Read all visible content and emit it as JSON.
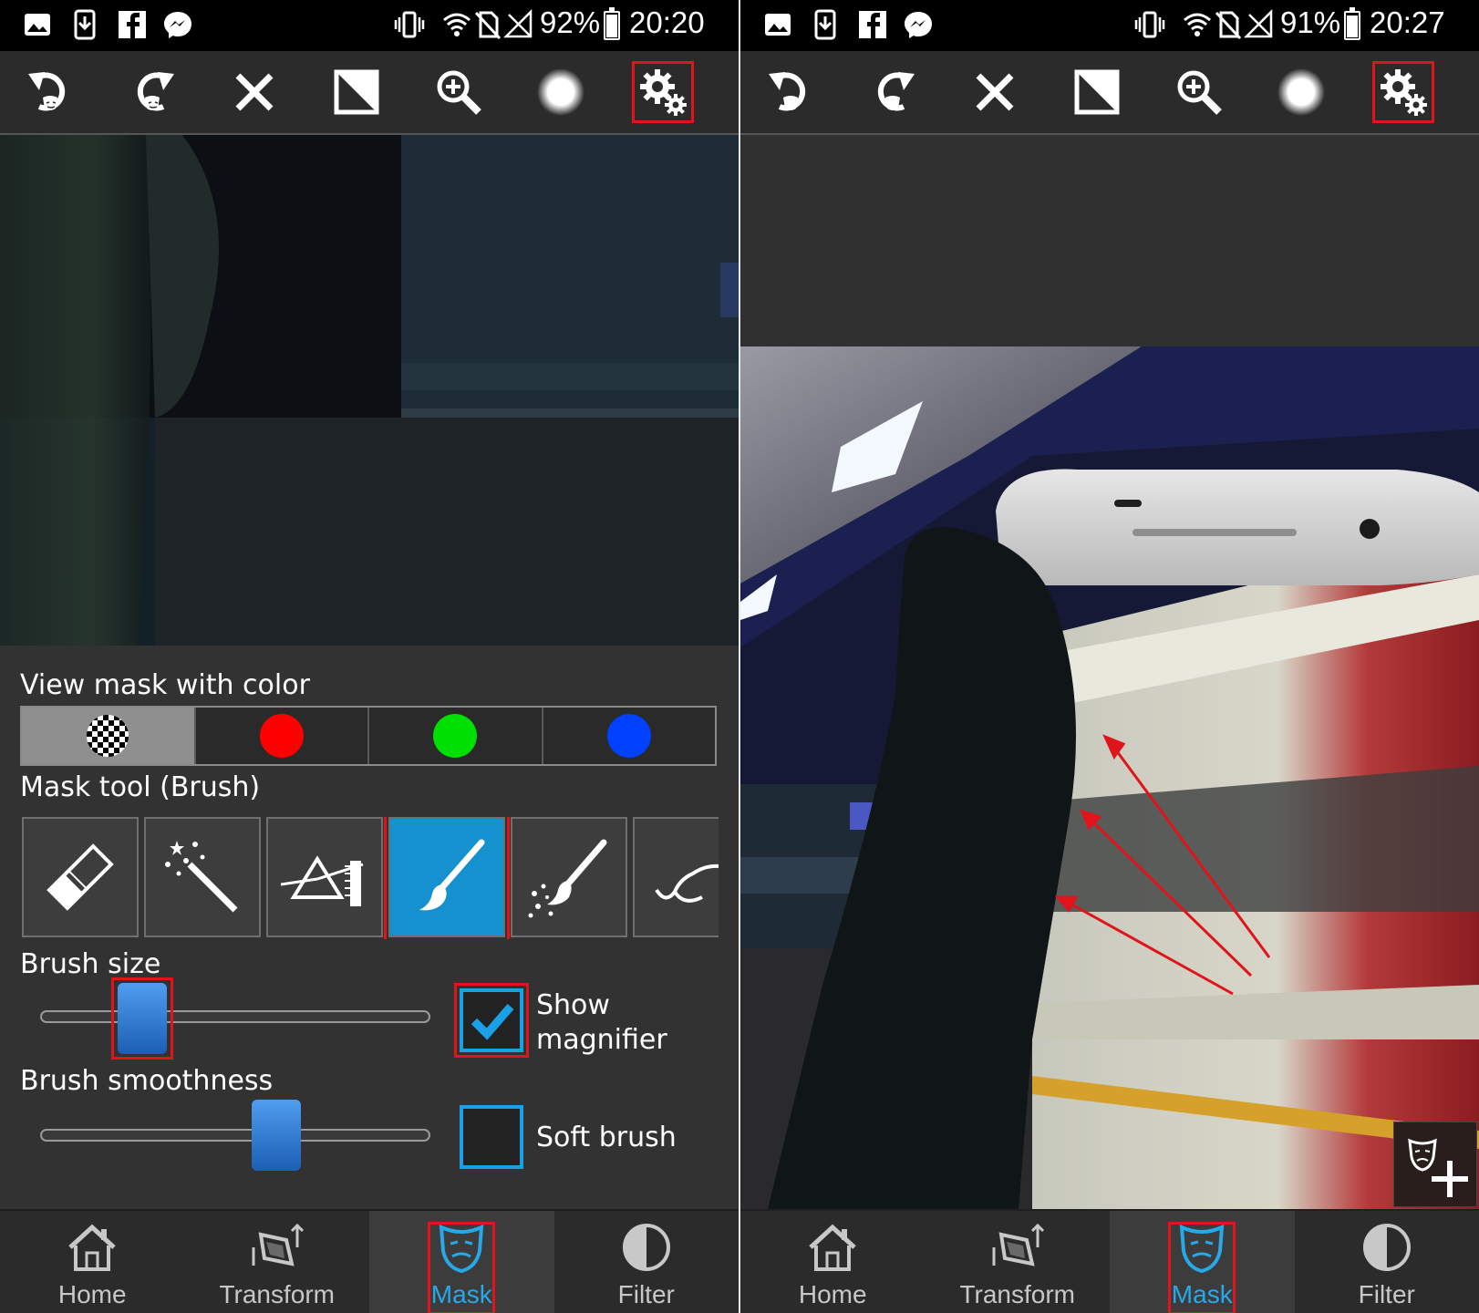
{
  "left": {
    "status": {
      "battery": "92%",
      "time": "20:20"
    },
    "settings": {
      "view_mask_label": "View mask with color",
      "mask_colors": [
        "transparent",
        "red",
        "green",
        "blue"
      ],
      "mask_color_hex": [
        "checker",
        "#ff0000",
        "#00e000",
        "#0040ff"
      ],
      "mask_tool_label": "Mask tool (Brush)",
      "tools": [
        "eraser",
        "magic-wand",
        "prism",
        "brush",
        "sparkle-brush",
        "lasso"
      ],
      "active_tool": "brush",
      "brush_size_label": "Brush size",
      "brush_size_value": 0.25,
      "brush_smoothness_label": "Brush smoothness",
      "brush_smoothness_value": 0.6,
      "show_magnifier_label": "Show\nmagnifier",
      "show_magnifier_checked": true,
      "soft_brush_label": "Soft brush",
      "soft_brush_checked": false
    }
  },
  "right": {
    "status": {
      "battery": "91%",
      "time": "20:27"
    }
  },
  "nav": [
    "Home",
    "Transform",
    "Mask",
    "Filter"
  ],
  "active_nav": "Mask",
  "toolbar_icons": [
    "undo-icon",
    "redo-icon",
    "close-icon",
    "invert-mask-icon",
    "zoom-in-icon",
    "brush-preview-icon",
    "settings-icon"
  ],
  "colors": {
    "accent": "#1691cf",
    "highlight": "#e0141b",
    "nav_active_text": "#28a8e8"
  }
}
